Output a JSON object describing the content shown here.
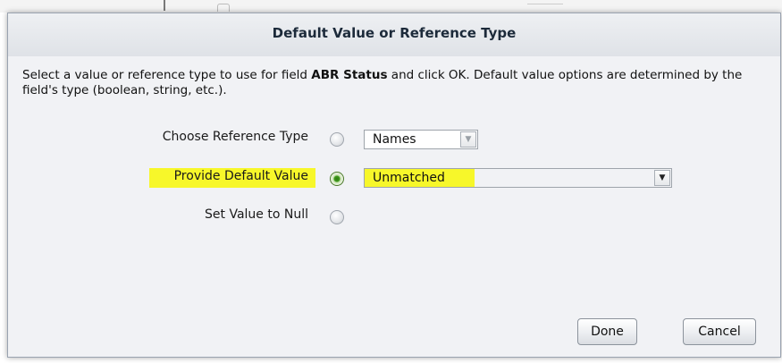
{
  "dialog": {
    "title": "Default Value or Reference Type",
    "intro_before": "Select a value or reference type to use for field ",
    "intro_field": "ABR Status",
    "intro_after": " and click OK. Default value options are determined by the field's type (boolean, string, etc.)."
  },
  "options": {
    "reference_type": {
      "label": "Choose Reference Type",
      "selected": false,
      "select_value": "Names",
      "enabled": false
    },
    "default_value": {
      "label": "Provide Default Value",
      "selected": true,
      "select_value": "Unmatched",
      "enabled": true
    },
    "null_value": {
      "label": "Set Value to Null",
      "selected": false
    }
  },
  "buttons": {
    "done": "Done",
    "cancel": "Cancel"
  },
  "colors": {
    "highlight": "#f7f72a",
    "radio_selected": "#3f9a1c"
  },
  "icons": {
    "dropdown": "chevron-down-icon"
  }
}
